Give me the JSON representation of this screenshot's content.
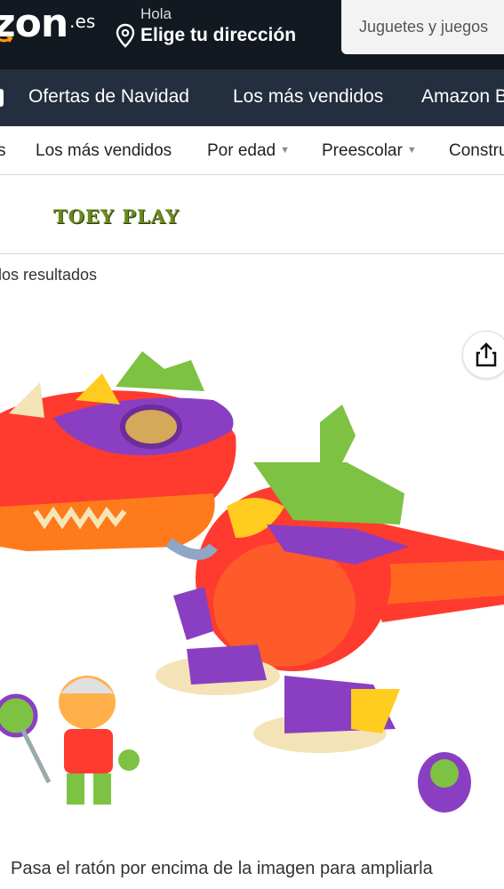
{
  "header": {
    "logo_text": "zon",
    "logo_tld": ".es",
    "location_greeting": "Hola",
    "location_action": "Elige tu dirección",
    "search_category": "Juguetes y juegos"
  },
  "nav": {
    "items": [
      "Ofertas de Navidad",
      "Los más vendidos",
      "Amazon B"
    ]
  },
  "subnav": {
    "leading_fragment": "s",
    "items": [
      {
        "label": "Los más vendidos",
        "dropdown": false
      },
      {
        "label": "Por edad",
        "dropdown": true
      },
      {
        "label": "Preescolar",
        "dropdown": true
      },
      {
        "label": "Constru",
        "dropdown": false
      }
    ]
  },
  "brand": {
    "logo_text": "TOEY PLAY"
  },
  "results": {
    "back_text": "los resultados"
  },
  "product": {
    "image_alt": "Dinosaurio de juguete rojo con figuras",
    "hover_hint": "Pasa el ratón por encima de la imagen para ampliarla"
  },
  "colors": {
    "header_bg": "#131921",
    "nav_bg": "#232f3e",
    "dino_red": "#ff3b2f",
    "dino_orange": "#ff7a1a",
    "armor_purple": "#8a3fc2",
    "armor_green": "#7dc242",
    "armor_yellow": "#ffcc1f"
  }
}
